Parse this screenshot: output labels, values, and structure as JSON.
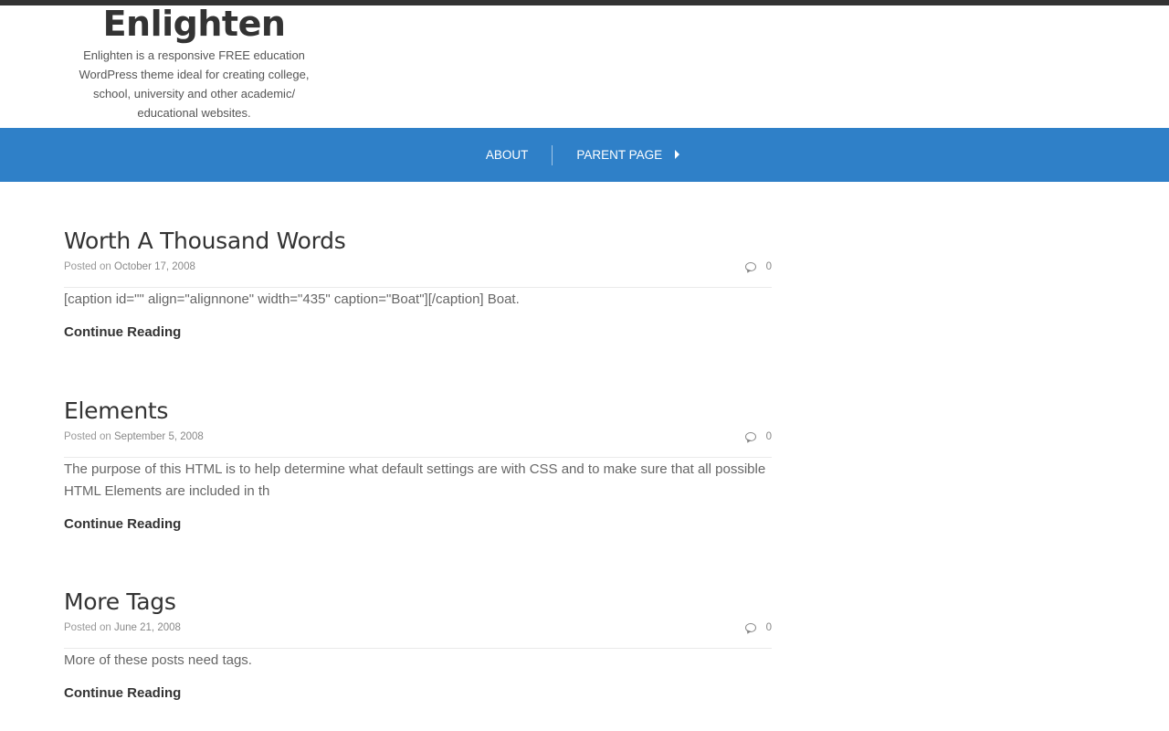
{
  "site": {
    "title": "Enlighten",
    "description": "Enlighten is a responsive FREE education WordPress theme ideal for creating college, school, university and other academic/ educational websites."
  },
  "nav": {
    "items": [
      {
        "label": "About"
      },
      {
        "label": "Parent Page"
      }
    ]
  },
  "posts": [
    {
      "title": "Worth A Thousand Words",
      "posted_prefix": "Posted on",
      "date": "October 17, 2008",
      "comments": "0",
      "excerpt": "[caption id=\"\" align=\"alignnone\" width=\"435\" caption=\"Boat\"][/caption] Boat.",
      "continue_label": "Continue Reading"
    },
    {
      "title": "Elements",
      "posted_prefix": "Posted on",
      "date": "September 5, 2008",
      "comments": "0",
      "excerpt": "The purpose of this HTML is to help determine what default settings are with CSS and to make sure that all possible HTML Elements are included in th",
      "continue_label": "Continue Reading"
    },
    {
      "title": "More Tags",
      "posted_prefix": "Posted on",
      "date": "June 21, 2008",
      "comments": "0",
      "excerpt": "More of these posts need tags.",
      "continue_label": "Continue Reading"
    }
  ],
  "colors": {
    "nav_background": "#2f80c8",
    "top_strip": "#333333",
    "title_text": "#333333",
    "body_text": "#666666",
    "meta_text": "#999999"
  },
  "icons": {
    "comment": "speech-bubble-icon",
    "submenu": "caret-right-icon"
  }
}
